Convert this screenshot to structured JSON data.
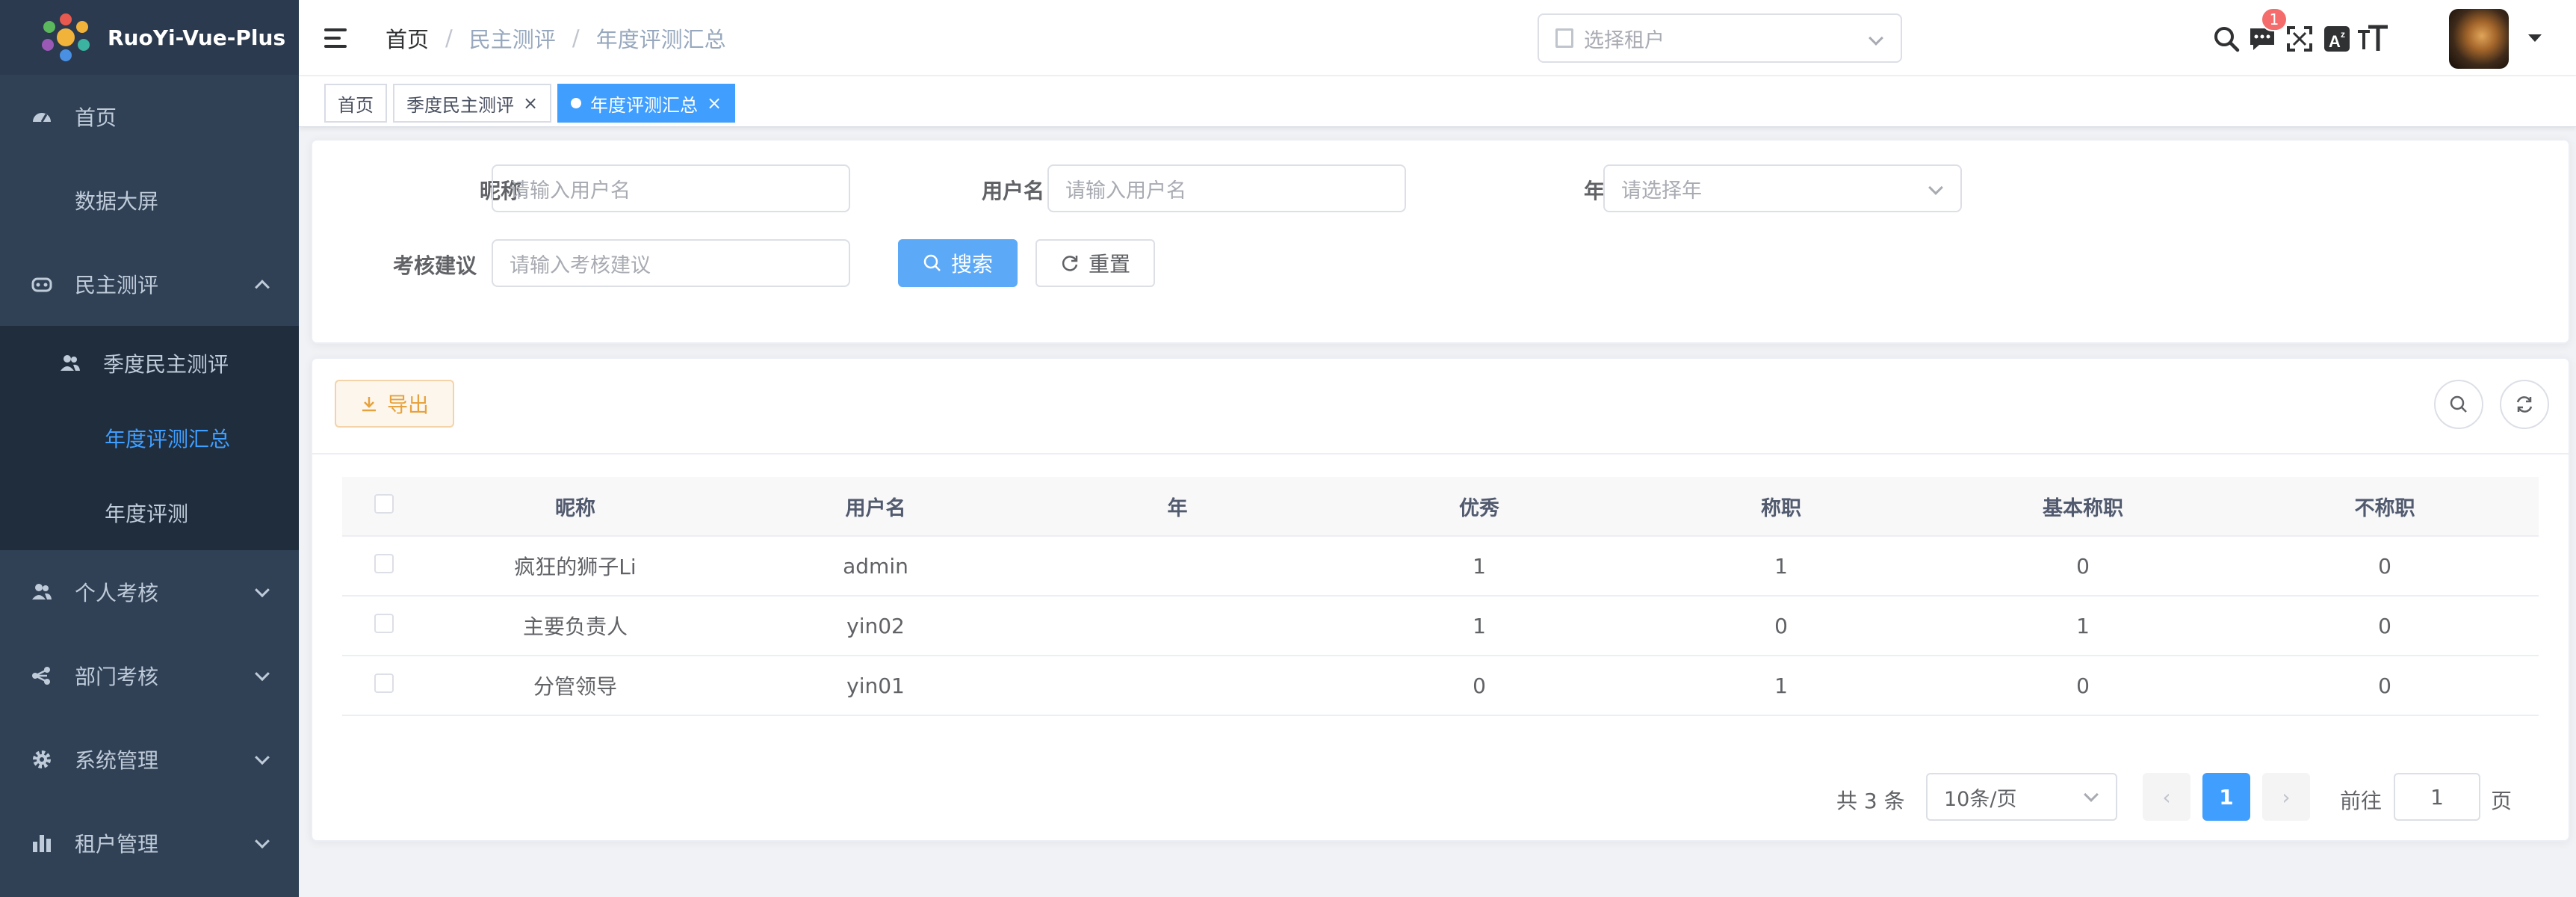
{
  "app": {
    "title": "RuoYi-Vue-Plus"
  },
  "sidebar": {
    "items": [
      {
        "label": "首页",
        "icon": "dashboard-icon"
      },
      {
        "label": "数据大屏"
      },
      {
        "label": "民主测评",
        "icon": "evaluation-icon",
        "expanded": true,
        "children": [
          {
            "label": "季度民主测评",
            "icon": "users-icon"
          },
          {
            "label": "年度评测汇总",
            "active": true
          },
          {
            "label": "年度评测"
          }
        ]
      },
      {
        "label": "个人考核",
        "icon": "user-icon"
      },
      {
        "label": "部门考核",
        "icon": "tree-icon"
      },
      {
        "label": "系统管理",
        "icon": "gear-icon"
      },
      {
        "label": "租户管理",
        "icon": "chart-icon"
      }
    ]
  },
  "navbar": {
    "breadcrumb": [
      "首页",
      "民主测评",
      "年度评测汇总"
    ],
    "tenant_placeholder": "选择租户",
    "notification_count": "1"
  },
  "tags": [
    {
      "label": "首页"
    },
    {
      "label": "季度民主测评"
    },
    {
      "label": "年度评测汇总",
      "active": true
    }
  ],
  "search": {
    "nickname_label": "昵称",
    "nickname_placeholder": "请输入用户名",
    "username_label": "用户名",
    "username_placeholder": "请输入用户名",
    "year_label": "年",
    "year_placeholder": "请选择年",
    "advice_label": "考核建议",
    "advice_placeholder": "请输入考核建议",
    "search_button": "搜索",
    "reset_button": "重置"
  },
  "toolbar": {
    "export_button": "导出"
  },
  "table": {
    "columns": [
      "昵称",
      "用户名",
      "年",
      "优秀",
      "称职",
      "基本称职",
      "不称职"
    ],
    "rows": [
      [
        "疯狂的狮子Li",
        "admin",
        "",
        "1",
        "1",
        "0",
        "0"
      ],
      [
        "主要负责人",
        "yin02",
        "",
        "1",
        "0",
        "1",
        "0"
      ],
      [
        "分管领导",
        "yin01",
        "",
        "0",
        "1",
        "0",
        "0"
      ]
    ]
  },
  "pagination": {
    "total_text": "共 3 条",
    "page_size": "10条/页",
    "current_page": "1",
    "goto_label": "前往",
    "goto_value": "1",
    "page_suffix": "页",
    "prev": "‹",
    "next": "›"
  },
  "colors": {
    "primary": "#409eff",
    "sidebar_bg": "#304156",
    "warning": "#e6a23c"
  }
}
